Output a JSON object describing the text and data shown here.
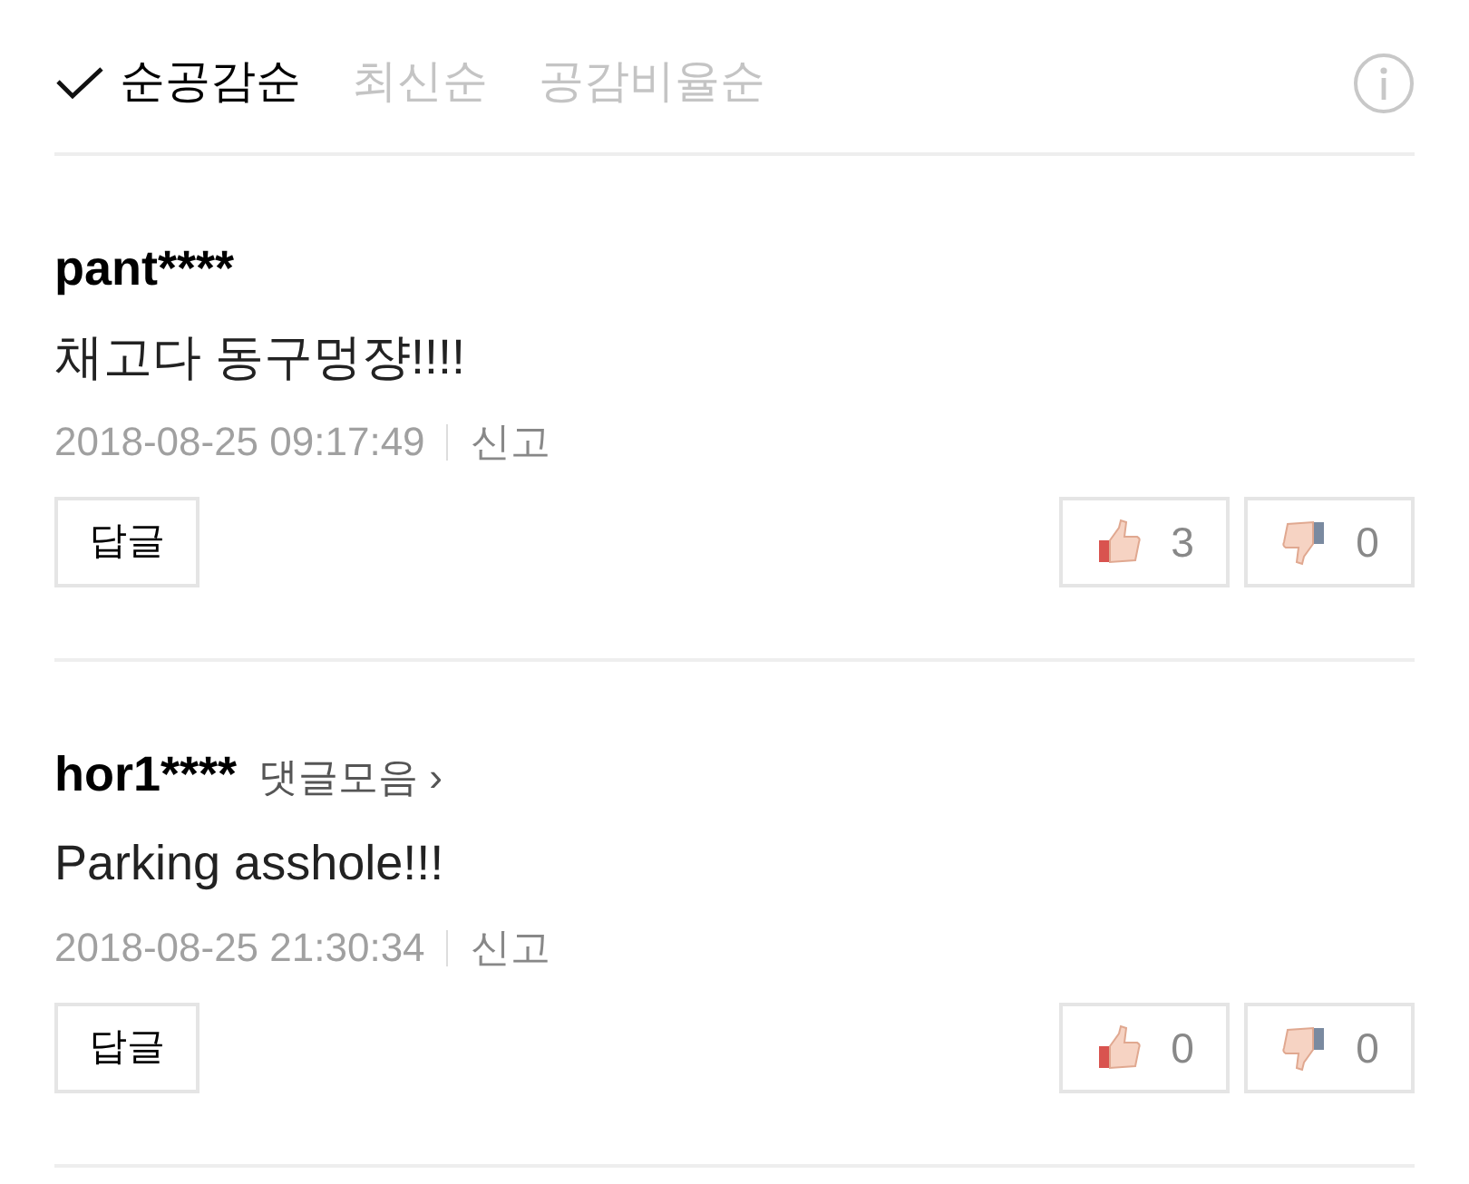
{
  "sort_tabs": [
    {
      "label": "순공감순",
      "selected": true
    },
    {
      "label": "최신순",
      "selected": false
    },
    {
      "label": "공감비율순",
      "selected": false
    }
  ],
  "comments": [
    {
      "user": "pant****",
      "text": "채고다 동구멍쟝!!!!",
      "date": "2018-08-25 09:17:49",
      "report": "신고",
      "reply": "답글",
      "likes": "3",
      "dislikes": "0"
    },
    {
      "user": "hor1****",
      "more_link": "댓글모음",
      "more_arrow": "›",
      "text": "Parking asshole!!!",
      "date": "2018-08-25 21:30:34",
      "report": "신고",
      "reply": "답글",
      "likes": "0",
      "dislikes": "0"
    }
  ]
}
